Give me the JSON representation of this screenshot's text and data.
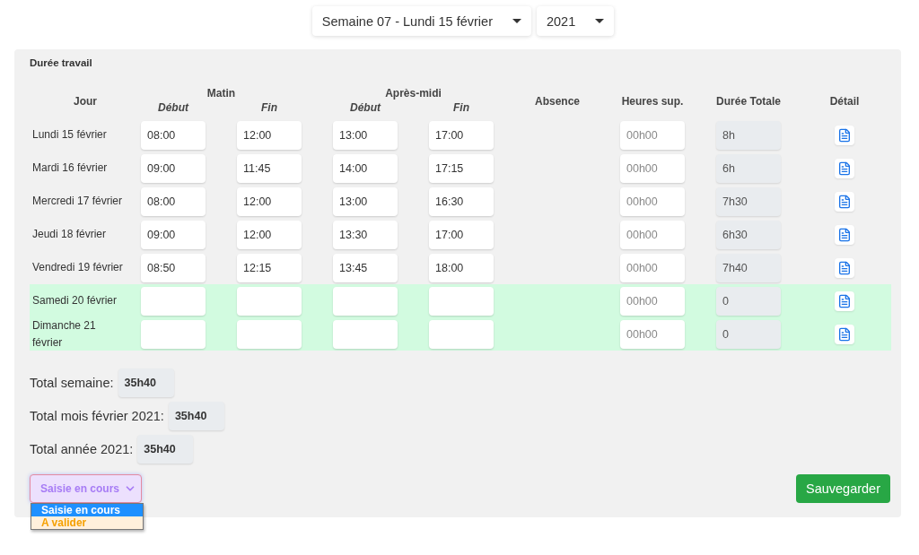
{
  "week_select": {
    "value": "Semaine 07 - Lundi 15 février"
  },
  "year_select": {
    "value": "2021"
  },
  "panel": {
    "title": "Durée travail"
  },
  "table": {
    "headers": {
      "day": "Jour",
      "morning": "Matin",
      "afternoon": "Après-midi",
      "start_1": "Début",
      "end_1": "Fin",
      "start_2": "Début",
      "end_2": "Fin",
      "absence": "Absence",
      "overtime": "Heures sup.",
      "total": "Durée Totale",
      "detail": "Détail"
    },
    "rows": [
      {
        "day": "Lundi 15 février",
        "weekend": false,
        "times": [
          "08:00",
          "12:00",
          "13:00",
          "17:00"
        ],
        "overtime_placeholder": "00h00",
        "total": "8h"
      },
      {
        "day": "Mardi 16 février",
        "weekend": false,
        "times": [
          "09:00",
          "11:45",
          "14:00",
          "17:15"
        ],
        "overtime_placeholder": "00h00",
        "total": "6h"
      },
      {
        "day": "Mercredi 17 février",
        "weekend": false,
        "times": [
          "08:00",
          "12:00",
          "13:00",
          "16:30"
        ],
        "overtime_placeholder": "00h00",
        "total": "7h30"
      },
      {
        "day": "Jeudi 18 février",
        "weekend": false,
        "times": [
          "09:00",
          "12:00",
          "13:30",
          "17:00"
        ],
        "overtime_placeholder": "00h00",
        "total": "6h30"
      },
      {
        "day": "Vendredi 19 février",
        "weekend": false,
        "times": [
          "08:50",
          "12:15",
          "13:45",
          "18:00"
        ],
        "overtime_placeholder": "00h00",
        "total": "7h40"
      },
      {
        "day": "Samedi 20 février",
        "weekend": true,
        "overtime_placeholder": "00h00",
        "total": "0"
      },
      {
        "day": "Dimanche 21 février",
        "weekend": true,
        "overtime_placeholder": "00h00",
        "total": "0"
      }
    ]
  },
  "totals": [
    {
      "label": "Total semaine:",
      "value": "35h40"
    },
    {
      "label": "Total mois février 2021:",
      "value": "35h40"
    },
    {
      "label": "Total année 2021:",
      "value": "35h40"
    }
  ],
  "status_select": {
    "value": "Saisie en cours",
    "open": true,
    "options": [
      {
        "label": "Saisie en cours",
        "selected": true
      },
      {
        "label": "A valider",
        "selected": false
      }
    ]
  },
  "save_button": "Sauvegarder"
}
